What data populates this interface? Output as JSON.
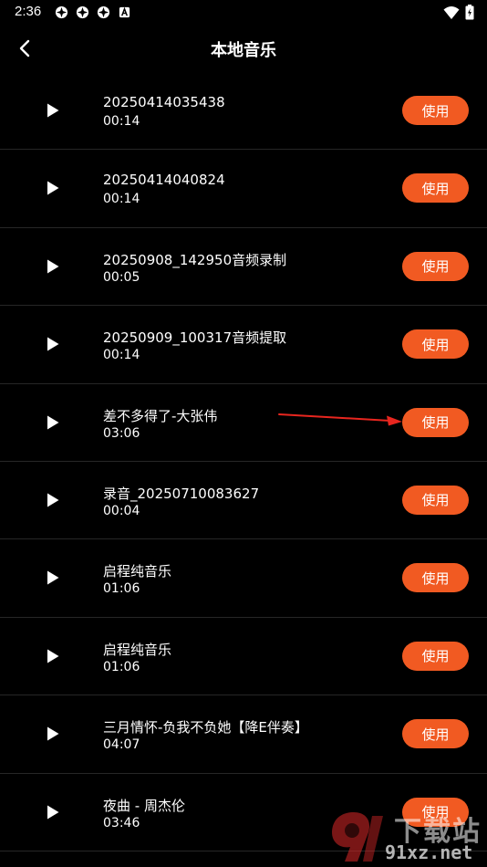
{
  "status_bar": {
    "time": "2:36",
    "notification_icons": [
      "app-notification-icon",
      "app-notification-icon",
      "app-notification-icon",
      "a-badge-icon"
    ],
    "right_icons": [
      "wifi-icon",
      "battery-icon"
    ]
  },
  "header": {
    "title": "本地音乐",
    "back_icon": "chevron-left-icon"
  },
  "colors": {
    "background": "#000000",
    "accent": "#f15a22",
    "divider": "#262626",
    "annotation": "#e8261f"
  },
  "use_label": "使用",
  "tracks": [
    {
      "name": "20250414035438",
      "duration": "00:14"
    },
    {
      "name": "20250414040824",
      "duration": "00:14"
    },
    {
      "name": "20250908_142950音频录制",
      "duration": "00:05"
    },
    {
      "name": "20250909_100317音频提取",
      "duration": "00:14"
    },
    {
      "name": "差不多得了-大张伟",
      "duration": "03:06"
    },
    {
      "name": "录音_20250710083627",
      "duration": "00:04"
    },
    {
      "name": "启程纯音乐",
      "duration": "01:06"
    },
    {
      "name": "启程纯音乐",
      "duration": "01:06"
    },
    {
      "name": "三月情怀-负我不负她【降E伴奏】",
      "duration": "04:07"
    },
    {
      "name": "夜曲 - 周杰伦",
      "duration": "03:46"
    }
  ],
  "watermark": {
    "top_text": "下载站",
    "bottom_text": "91xz.net"
  }
}
